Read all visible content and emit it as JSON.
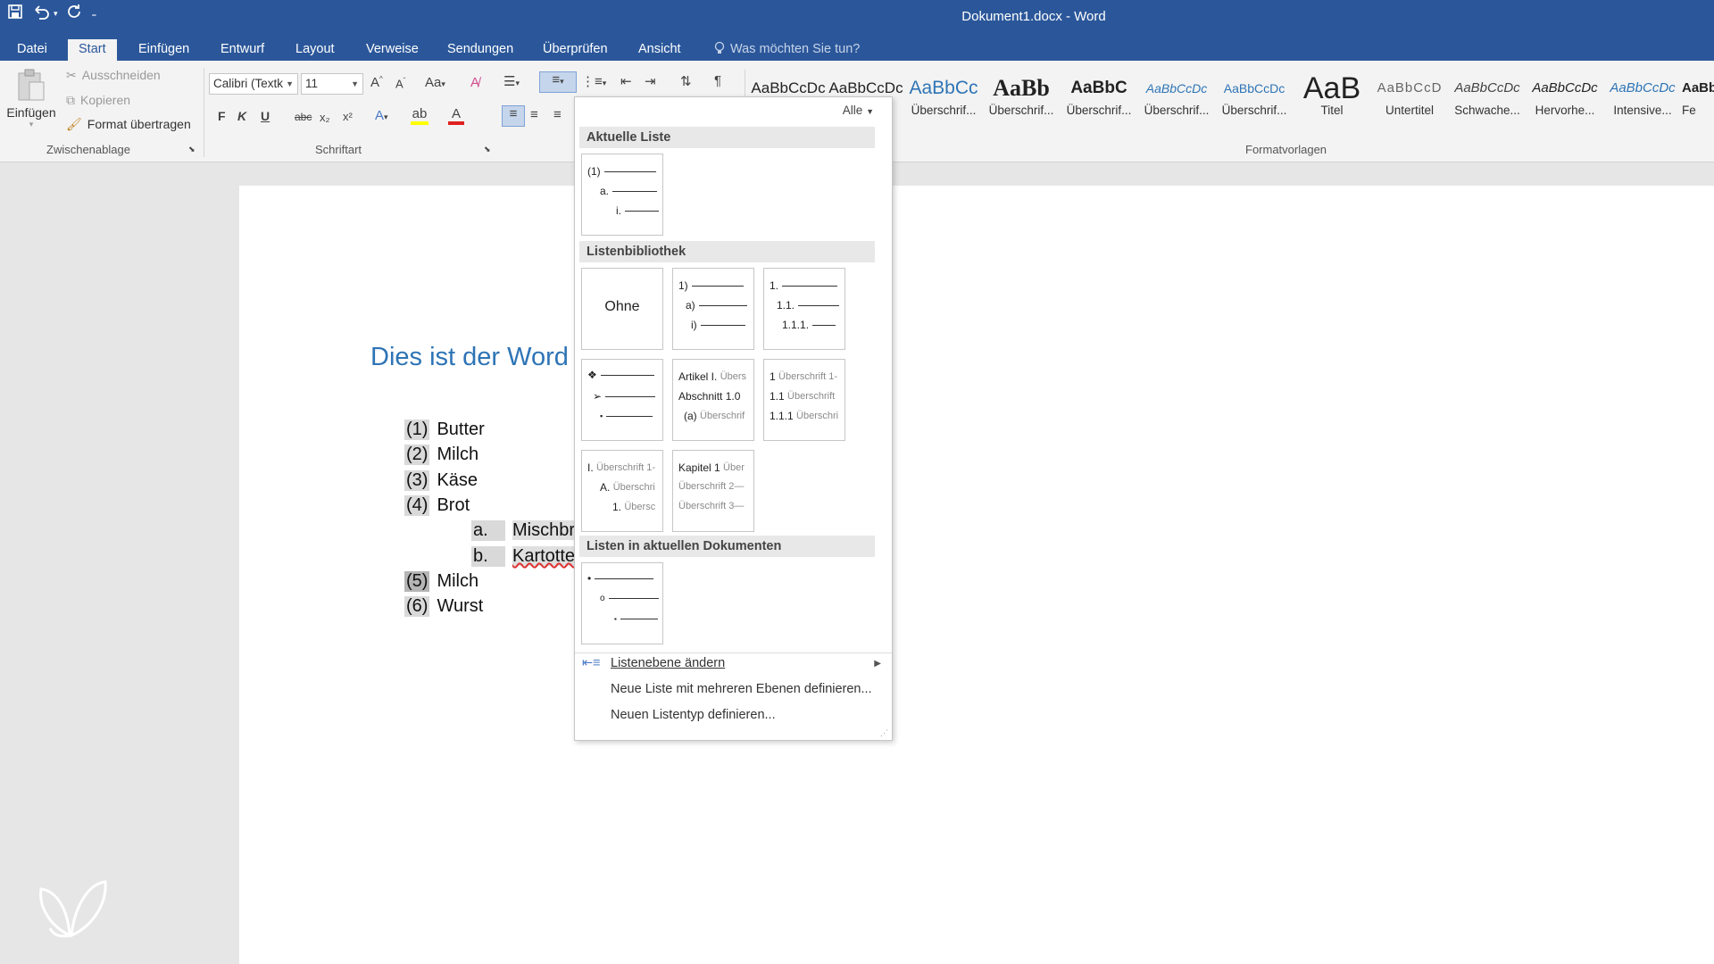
{
  "window": {
    "title": "Dokument1.docx - Word"
  },
  "qat": {
    "save_icon": "save-icon",
    "undo_icon": "undo-icon",
    "redo_icon": "redo-icon"
  },
  "tabs": [
    {
      "label": "Datei"
    },
    {
      "label": "Start"
    },
    {
      "label": "Einfügen"
    },
    {
      "label": "Entwurf"
    },
    {
      "label": "Layout"
    },
    {
      "label": "Verweise"
    },
    {
      "label": "Sendungen"
    },
    {
      "label": "Überprüfen"
    },
    {
      "label": "Ansicht"
    }
  ],
  "active_tab": "Start",
  "tellme": {
    "placeholder": "Was möchten Sie tun?"
  },
  "clipboard": {
    "paste": "Einfügen",
    "cut": "Ausschneiden",
    "copy": "Kopieren",
    "format_painter": "Format übertragen",
    "group": "Zwischenablage"
  },
  "font": {
    "name": "Calibri (Textk",
    "size": "11",
    "group": "Schriftart",
    "bold": "F",
    "italic": "K",
    "underline": "U",
    "strike": "abc",
    "sub": "x₂",
    "sup": "x²",
    "case": "Aa"
  },
  "styles": {
    "group": "Formatvorlagen",
    "items": [
      {
        "preview": "AaBbCcDc",
        "name": ""
      },
      {
        "preview": "AaBbCcDc",
        "name": "."
      },
      {
        "preview": "AaBbCc",
        "name": "Überschrif..."
      },
      {
        "preview": "AaBb",
        "name": "Überschrif..."
      },
      {
        "preview": "AaBbC",
        "name": "Überschrif..."
      },
      {
        "preview": "AaBbCcDc",
        "name": "Überschrif..."
      },
      {
        "preview": "AaBbCcDc",
        "name": "Überschrif..."
      },
      {
        "preview": "AaB",
        "name": "Titel"
      },
      {
        "preview": "AaBbCcD",
        "name": "Untertitel"
      },
      {
        "preview": "AaBbCcDc",
        "name": "Schwache..."
      },
      {
        "preview": "AaBbCcDc",
        "name": "Hervorhe..."
      },
      {
        "preview": "AaBbCcDc",
        "name": "Intensive..."
      },
      {
        "preview": "AaBb",
        "name": "Fe"
      }
    ]
  },
  "document": {
    "heading": "Dies ist der Word",
    "list": [
      {
        "num": "(1)",
        "text": "Butter"
      },
      {
        "num": "(2)",
        "text": "Milch"
      },
      {
        "num": "(3)",
        "text": "Käse"
      },
      {
        "num": "(4)",
        "text": "Brot"
      },
      {
        "num": "a.",
        "text": "Mischbr"
      },
      {
        "num": "b.",
        "text": "Kartotte"
      },
      {
        "num": "(5)",
        "text": "Milch"
      },
      {
        "num": "(6)",
        "text": "Wurst"
      }
    ]
  },
  "gallery": {
    "filter": "Alle",
    "section_current": "Aktuelle Liste",
    "section_library": "Listenbibliothek",
    "section_documents": "Listen in aktuellen Dokumenten",
    "current": {
      "l1": "(1)",
      "l2": "a.",
      "l3": "i."
    },
    "none_label": "Ohne",
    "lib_paren": {
      "l1": "1)",
      "l2": "a)",
      "l3": "i)"
    },
    "lib_decimal": {
      "l1": "1.",
      "l2": "1.1.",
      "l3": "1.1.1."
    },
    "lib_bullets": {
      "l1": "❖",
      "l2": "➢",
      "l3": "▪"
    },
    "lib_artikel": {
      "l1a": "Artikel I.",
      "l1b": "Übers",
      "l2": "Abschnitt 1.0",
      "l3a": "(a)",
      "l3b": "Überschrif"
    },
    "lib_heading_num": {
      "l1a": "1",
      "l1b": "Überschrift 1-",
      "l2a": "1.1",
      "l2b": "Überschrift",
      "l3a": "1.1.1",
      "l3b": "Überschri"
    },
    "lib_heading_roman": {
      "l1a": "I.",
      "l1b": "Überschrift 1-",
      "l2a": "A.",
      "l2b": "Überschri",
      "l3a": "1.",
      "l3b": "Übersc"
    },
    "lib_kapitel": {
      "l1a": "Kapitel 1",
      "l1b": "Über",
      "l2": "Überschrift 2—",
      "l3": "Überschrift 3—"
    },
    "doc_list": {
      "l1": "•",
      "l2": "o",
      "l3": "▪"
    },
    "menu": [
      {
        "label": "Listenebene ändern"
      },
      {
        "label": "Neue Liste mit mehreren Ebenen definieren..."
      },
      {
        "label": "Neuen Listentyp definieren..."
      }
    ]
  },
  "colors": {
    "accent": "#2b579a",
    "heading": "#2e74b5",
    "font_color_bar": "#e02020",
    "highlight_bar": "#ffff00"
  }
}
